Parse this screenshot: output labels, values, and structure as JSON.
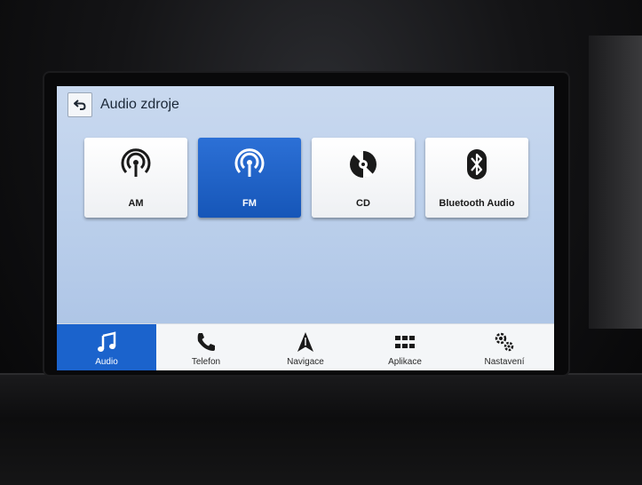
{
  "header": {
    "title": "Audio zdroje",
    "back_icon": "back-arrow-icon"
  },
  "sources": [
    {
      "label": "AM",
      "icon": "radio-antenna-icon",
      "selected": false
    },
    {
      "label": "FM",
      "icon": "radio-antenna-icon",
      "selected": true
    },
    {
      "label": "CD",
      "icon": "disc-icon",
      "selected": false
    },
    {
      "label": "Bluetooth Audio",
      "icon": "bluetooth-icon",
      "selected": false
    }
  ],
  "nav": {
    "items": [
      {
        "label": "Audio",
        "icon": "music-note-icon",
        "active": true
      },
      {
        "label": "Telefon",
        "icon": "phone-icon",
        "active": false
      },
      {
        "label": "Navigace",
        "icon": "navigation-arrow-icon",
        "active": false
      },
      {
        "label": "Aplikace",
        "icon": "apps-grid-icon",
        "active": false
      },
      {
        "label": "Nastavení",
        "icon": "gears-icon",
        "active": false
      }
    ]
  },
  "colors": {
    "accent": "#1b63cc",
    "screen_background": "#bcd0eb",
    "tile_background": "#f7f8fa"
  }
}
